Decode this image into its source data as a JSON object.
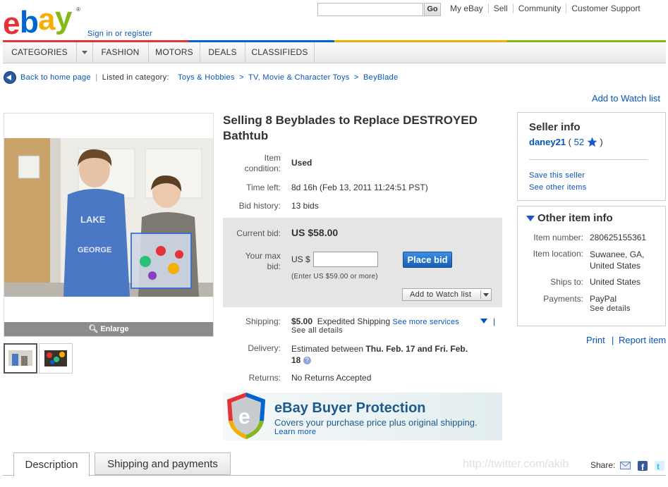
{
  "header": {
    "logo_text": "ebay",
    "signin": "Sign in or register",
    "search_placeholder": "",
    "go_label": "Go",
    "top_links": [
      "My eBay",
      "Sell",
      "Community",
      "Customer Support"
    ]
  },
  "nav": {
    "items": [
      "CATEGORIES",
      "FASHION",
      "MOTORS",
      "DEALS",
      "CLASSIFIEDS"
    ]
  },
  "breadcrumb": {
    "back": "Back to home page",
    "listed_in": "Listed in category:",
    "path": [
      "Toys & Hobbies",
      ">",
      "TV, Movie & Character Toys",
      ">",
      "BeyBlade"
    ]
  },
  "watch_top": "Add to Watch list",
  "image": {
    "enlarge": "Enlarge"
  },
  "item": {
    "title": "Selling 8 Beyblades to Replace DESTROYED Bathtub",
    "condition_label_1": "Item",
    "condition_label_2": "condition:",
    "condition": "Used",
    "time_left_label": "Time left:",
    "time_left": "8d 16h (Feb 13, 2011 11:24:51 PST)",
    "bid_history_label": "Bid history:",
    "bid_history": "13 bids",
    "current_bid_label": "Current bid:",
    "current_bid": "US $58.00",
    "max_bid_label_1": "Your max",
    "max_bid_label_2": "bid:",
    "currency": "US $",
    "bid_hint": "(Enter US $59.00 or more)",
    "place_bid": "Place bid",
    "add_watch": "Add to Watch list",
    "shipping_label": "Shipping:",
    "shipping_cost": "$5.00",
    "shipping_method": "Expedited Shipping",
    "see_more_services": "See more services",
    "see_all_details": "See all details",
    "delivery_label": "Delivery:",
    "delivery_prefix": "Estimated between",
    "delivery_dates_1": "Thu. Feb. 17 and Fri. Feb.",
    "delivery_dates_2": "18",
    "returns_label": "Returns:",
    "returns": "No Returns Accepted"
  },
  "protection": {
    "title": "eBay Buyer Protection",
    "subtitle": "Covers your purchase price plus original shipping.",
    "learn_more": "Learn more"
  },
  "seller": {
    "heading": "Seller info",
    "name": "daney21",
    "feedback_open": "(",
    "feedback": "52",
    "feedback_close": ")",
    "save_seller": "Save this seller",
    "see_other": "See other items"
  },
  "other_info": {
    "heading": "Other item info",
    "item_number_label": "Item number:",
    "item_number": "280625155361",
    "location_label": "Item location:",
    "location_1": "Suwanee, GA,",
    "location_2": "United States",
    "ships_to_label": "Ships to:",
    "ships_to": "United States",
    "payments_label": "Payments:",
    "payments": "PayPal",
    "see_details": "See details"
  },
  "actions": {
    "print": "Print",
    "report": "Report item"
  },
  "tabs": {
    "description": "Description",
    "shipping": "Shipping and payments"
  },
  "share_label": "Share:",
  "watermark": "http://twitter.com/akib",
  "colors": {
    "link": "#0654ba",
    "button": "#1a5fb4",
    "brand_red": "#e53238",
    "brand_blue": "#0064d2",
    "brand_yellow": "#f5af02",
    "brand_green": "#86b817"
  }
}
